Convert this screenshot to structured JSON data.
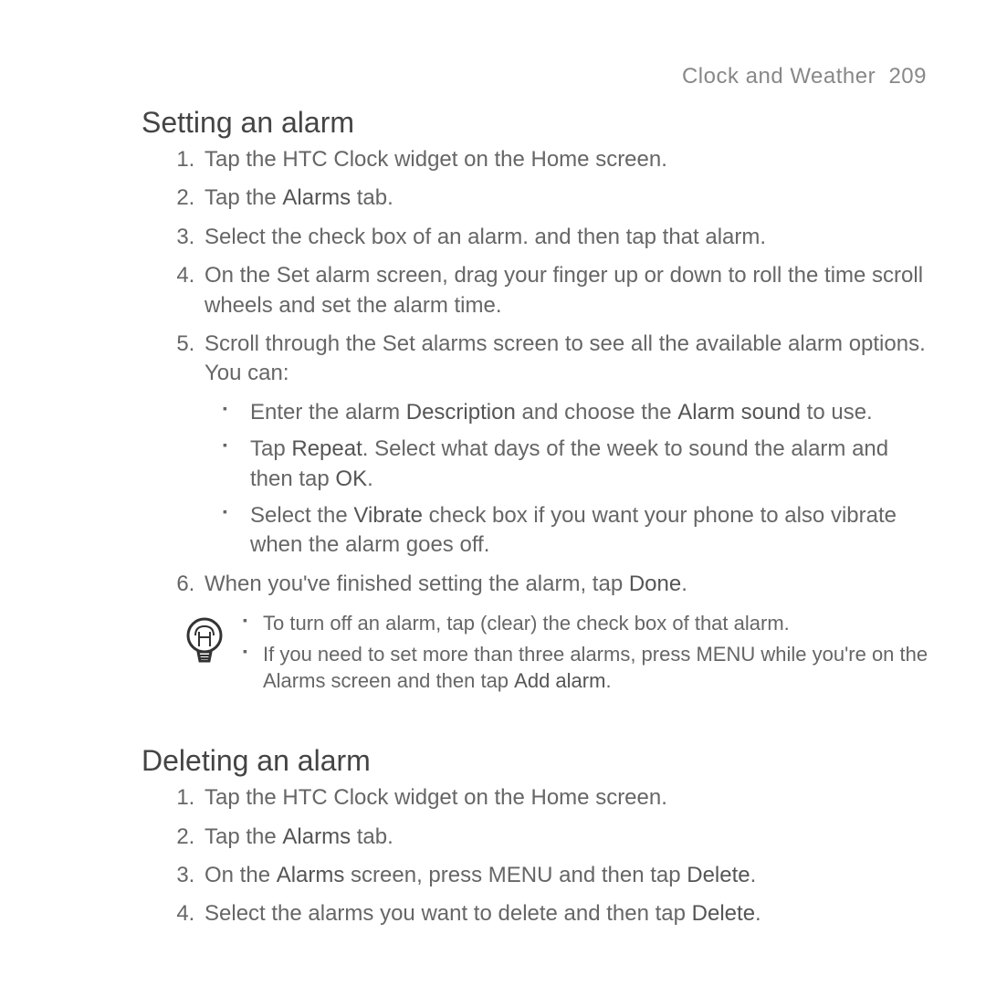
{
  "header": {
    "section": "Clock and Weather",
    "page": "209"
  },
  "setting": {
    "title": "Setting an alarm",
    "steps": {
      "s1": "Tap the HTC Clock widget on the Home screen.",
      "s2a": "Tap the ",
      "s2b": "Alarms",
      "s2c": " tab.",
      "s3": "Select the check box of an alarm. and then tap that alarm.",
      "s4": "On the Set alarm screen, drag your finger up or down to roll the time scroll wheels and set the alarm time.",
      "s5": "Scroll through the Set alarms screen to see all the available alarm options. You can:",
      "s5_1a": "Enter the alarm ",
      "s5_1b": "Description",
      "s5_1c": " and choose the ",
      "s5_1d": "Alarm sound",
      "s5_1e": " to use.",
      "s5_2a": "Tap ",
      "s5_2b": "Repeat",
      "s5_2c": ". Select what days of the week to sound the alarm and then tap ",
      "s5_2d": "OK",
      "s5_2e": ".",
      "s5_3a": "Select the ",
      "s5_3b": "Vibrate",
      "s5_3c": " check box if you want your phone to also vibrate when the alarm goes off.",
      "s6a": "When you've finished setting the alarm, tap ",
      "s6b": "Done",
      "s6c": "."
    },
    "tips": {
      "t1": "To turn off an alarm, tap (clear) the check box of that alarm.",
      "t2a": "If you need to set more than three alarms, press MENU while you're on the Alarms screen and then tap ",
      "t2b": "Add alarm",
      "t2c": "."
    }
  },
  "deleting": {
    "title": "Deleting an alarm",
    "steps": {
      "d1": "Tap the HTC Clock widget on the Home screen.",
      "d2a": "Tap the ",
      "d2b": "Alarms",
      "d2c": " tab.",
      "d3a": "On the ",
      "d3b": "Alarms",
      "d3c": " screen, press MENU and then tap ",
      "d3d": "Delete",
      "d3e": ".",
      "d4a": "Select the alarms you want to delete and then tap ",
      "d4b": "Delete",
      "d4c": "."
    }
  }
}
